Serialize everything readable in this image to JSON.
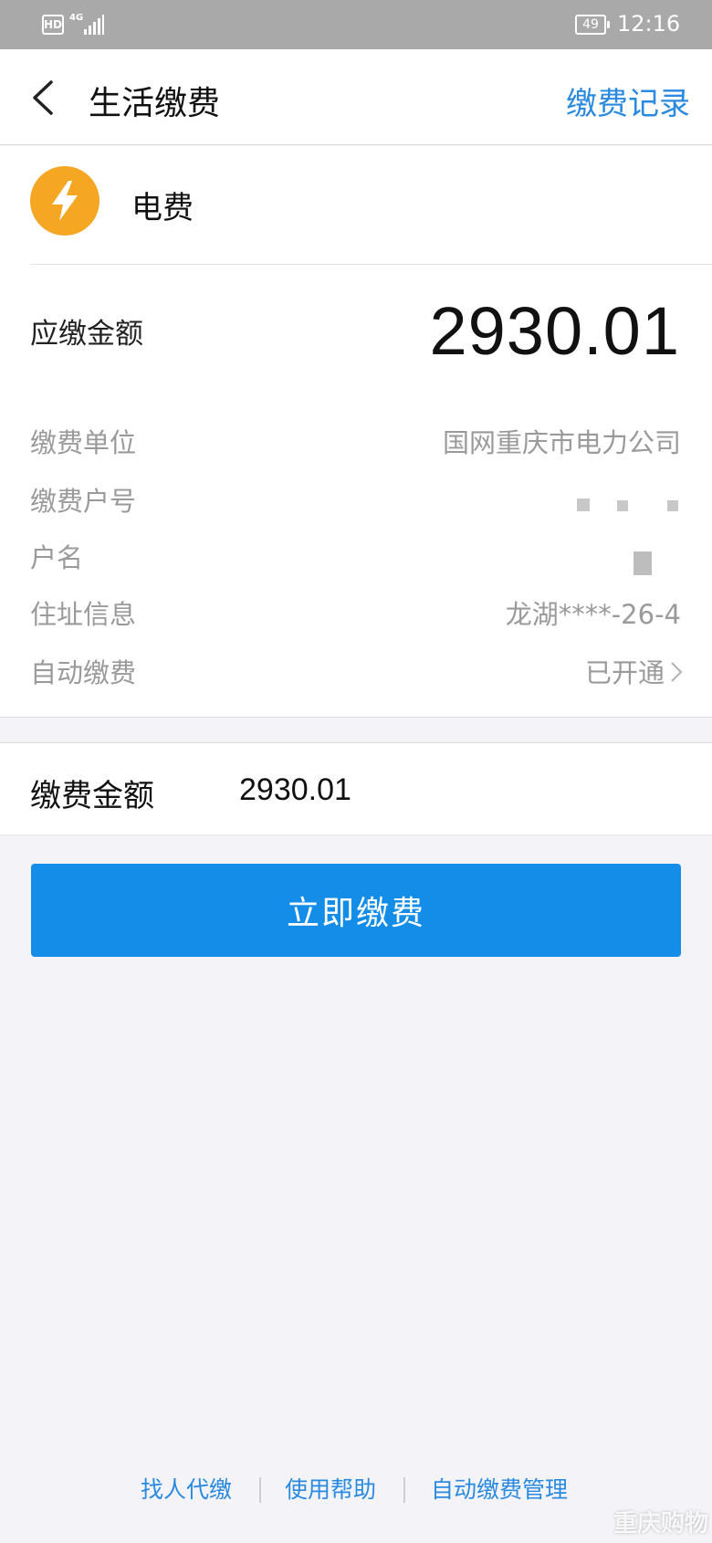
{
  "status_bar": {
    "hd": "HD",
    "network": "4G",
    "battery": "49",
    "time": "12:16"
  },
  "nav": {
    "title": "生活缴费",
    "record_link": "缴费记录"
  },
  "biller": {
    "name": "电费",
    "icon": "lightning-icon",
    "icon_color": "#f5a623"
  },
  "bill": {
    "due_label": "应缴金额",
    "due_amount": "2930.01",
    "rows": [
      {
        "label": "缴费单位",
        "value": "国网重庆市电力公司"
      },
      {
        "label": "缴费户号",
        "value": ""
      },
      {
        "label": "户名",
        "value": ""
      },
      {
        "label": "住址信息",
        "value": "龙湖****-26-4"
      },
      {
        "label": "自动缴费",
        "value": "已开通"
      }
    ]
  },
  "payment": {
    "label": "缴费金额",
    "amount": "2930.01"
  },
  "button": {
    "label": "立即缴费",
    "color": "#138de8"
  },
  "footer": {
    "links": [
      "找人代缴",
      "使用帮助",
      "自动缴费管理"
    ]
  },
  "watermark": "重庆购物"
}
